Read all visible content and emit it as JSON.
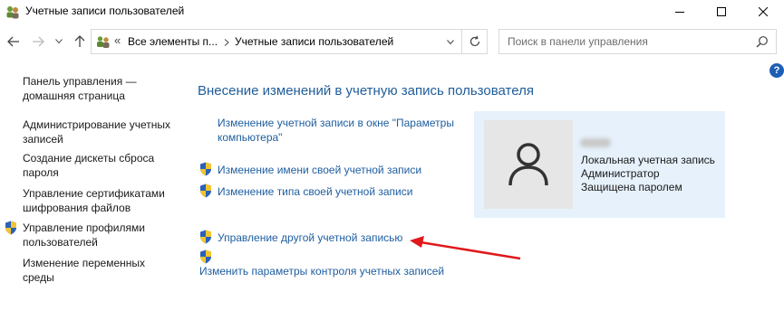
{
  "window": {
    "title": "Учетные записи пользователей"
  },
  "address_bar": {
    "overflow": "«",
    "crumbs": [
      "Все элементы п...",
      "Учетные записи пользователей"
    ]
  },
  "search": {
    "placeholder": "Поиск в панели управления"
  },
  "help_label": "?",
  "sidebar": {
    "items": [
      {
        "label_lines": [
          "Панель управления —",
          "домашняя страница"
        ],
        "shield": false
      },
      {
        "label_lines": [
          "Администрирование учетных",
          "записей"
        ],
        "shield": false
      },
      {
        "label_lines": [
          "Создание дискеты сброса",
          "пароля"
        ],
        "shield": false
      },
      {
        "label_lines": [
          "Управление сертификатами",
          "шифрования файлов"
        ],
        "shield": false
      },
      {
        "label_lines": [
          "Управление профилями",
          "пользователей"
        ],
        "shield": true
      },
      {
        "label_lines": [
          "Изменение переменных",
          "среды"
        ],
        "shield": false
      }
    ]
  },
  "main": {
    "heading": "Внесение изменений в учетную запись пользователя",
    "links": [
      {
        "label_lines": [
          "Изменение учетной записи в окне \"Параметры",
          "компьютера\""
        ],
        "shield": false
      },
      {
        "label_lines": [
          "Изменение имени своей учетной записи"
        ],
        "shield": true
      },
      {
        "label_lines": [
          "Изменение типа своей учетной записи"
        ],
        "shield": true
      },
      {
        "label_lines": [
          "Управление другой учетной записью"
        ],
        "shield": true
      },
      {
        "label_lines": [
          "Изменить параметры контроля учетных записей"
        ],
        "shield": true
      }
    ]
  },
  "account": {
    "lines": [
      "Локальная учетная запись",
      "Администратор",
      "Защищена паролем"
    ]
  },
  "colors": {
    "link": "#1f5ea0",
    "heading": "#1f5d99",
    "card_bg": "#e6f1fb",
    "arrow": "#e0191c"
  }
}
